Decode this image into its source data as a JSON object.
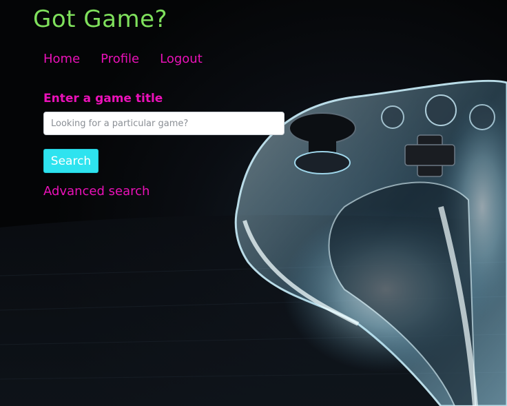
{
  "brand": {
    "title": "Got Game?"
  },
  "nav": {
    "items": [
      {
        "label": "Home"
      },
      {
        "label": "Profile"
      },
      {
        "label": "Logout"
      }
    ]
  },
  "search": {
    "label": "Enter a game title",
    "placeholder": "Looking for a particular game?",
    "value": "",
    "button_label": "Search",
    "advanced_link": "Advanced search"
  },
  "background": {
    "image": "game-controller-photo",
    "glow_color": "#bfefff"
  },
  "colors": {
    "brand": "#7fe05c",
    "links": "#ea11b8",
    "button": "#2ee3ef"
  }
}
